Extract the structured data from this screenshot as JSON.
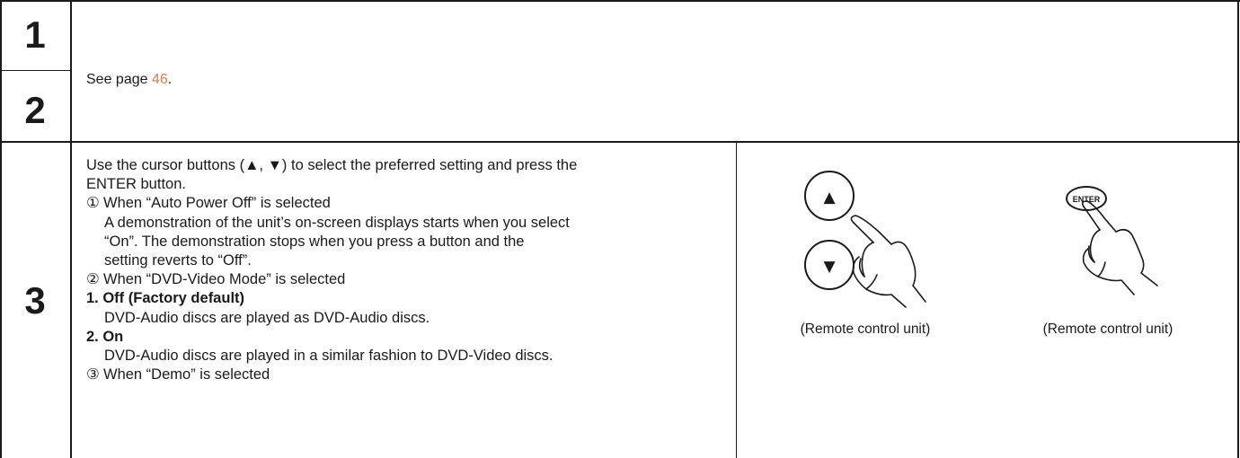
{
  "steps": {
    "s1": "1",
    "s2": "2",
    "s3": "3"
  },
  "ref": {
    "prefix": "See page ",
    "page": "46",
    "suffix": "."
  },
  "step3": {
    "intro_line1": "Use the cursor buttons (▲, ▼) to select the preferred setting and press the",
    "intro_line2": "ENTER button.",
    "item1_marker": "①",
    "item1_title": "When “Auto Power Off” is selected",
    "item1_desc_line1": "A demonstration of the unit’s on-screen displays starts when you select",
    "item1_desc_line2": "“On”.  The demonstration stops when you press a button and the",
    "item1_desc_line3": "setting reverts to “Off”.",
    "item2_marker": "②",
    "item2_title": "When “DVD-Video Mode” is selected",
    "opt1_label": "1. Off (Factory default)",
    "opt1_desc": "DVD-Audio discs are played as DVD-Audio discs.",
    "opt2_label": "2. On",
    "opt2_desc": "DVD-Audio discs are played in a similar fashion to DVD-Video discs.",
    "item3_marker": "③",
    "item3_title": "When “Demo” is selected"
  },
  "illustrations": {
    "cursor_caption": "(Remote control unit)",
    "enter_caption": "(Remote control unit)",
    "up_icon": "▲",
    "down_icon": "▼",
    "enter_label": "ENTER"
  },
  "colors": {
    "page_link": "#e07a4a",
    "rule": "#1a1a1a"
  }
}
